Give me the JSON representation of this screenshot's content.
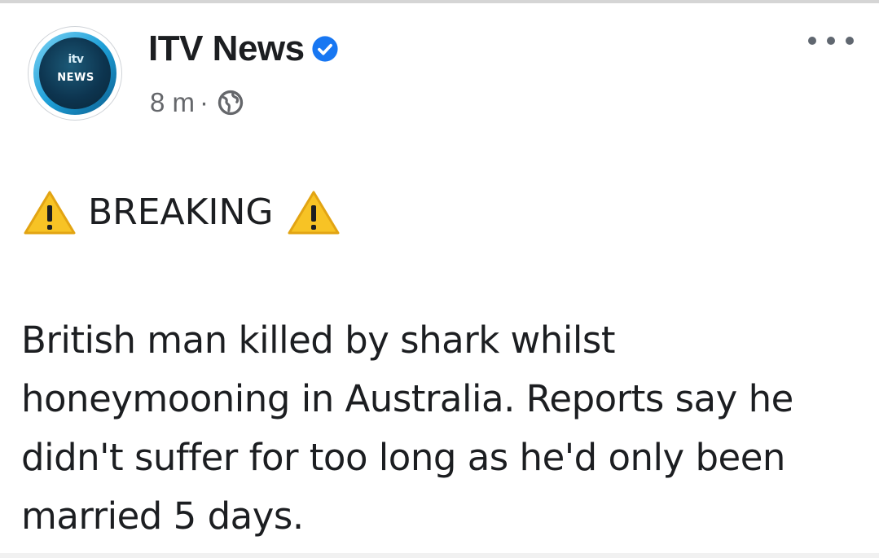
{
  "post": {
    "author": {
      "name": "ITV News",
      "avatar_brand": "itv",
      "avatar_word": "NEWS",
      "verified": true,
      "verified_color": "#1877f2"
    },
    "meta": {
      "time": "8 m",
      "separator": "·",
      "audience_icon": "globe-icon"
    },
    "more_icon": "ellipsis-icon",
    "headline": {
      "prefix_icon": "warning-icon",
      "text": "BREAKING",
      "suffix_icon": "warning-icon",
      "icon_color": "#f7c325"
    },
    "body": "British man killed by shark whilst honeymooning in Australia. Reports say he didn't suffer for too long as he'd only been married 5 days."
  }
}
